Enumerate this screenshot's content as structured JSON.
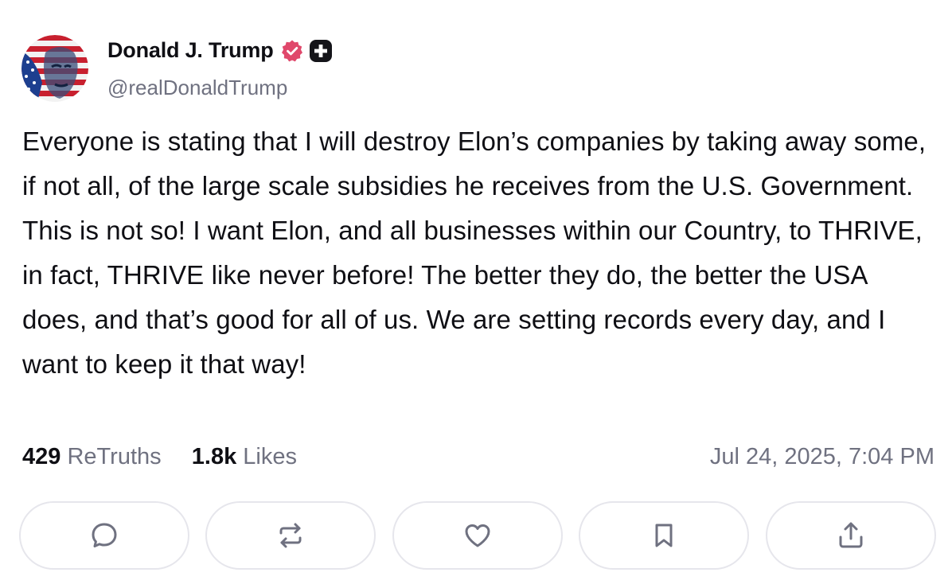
{
  "author": {
    "name": "Donald J. Trump",
    "handle": "@realDonaldTrump",
    "verified_color": "#e0486b",
    "plus_badge_color": "#141419"
  },
  "post": {
    "text": "Everyone is stating that I will destroy Elon’s companies by taking away some, if not all, of the large scale subsidies he receives from the U.S. Government. This is not so! I want Elon, and all businesses within our Country, to THRIVE, in fact, THRIVE like never before! The better they do, the better the USA does, and that’s good for all of us. We are setting records every day, and I want to keep it that way!",
    "retruths_count": "429",
    "retruths_label": "ReTruths",
    "likes_count": "1.8k",
    "likes_label": "Likes",
    "timestamp": "Jul 24, 2025, 7:04 PM"
  },
  "actions": [
    {
      "icon": "comment-icon"
    },
    {
      "icon": "retruth-icon"
    },
    {
      "icon": "heart-icon"
    },
    {
      "icon": "bookmark-icon"
    },
    {
      "icon": "share-icon"
    }
  ],
  "colors": {
    "text": "#0f0f14",
    "muted": "#6f7180",
    "border": "#e6e6ec"
  }
}
